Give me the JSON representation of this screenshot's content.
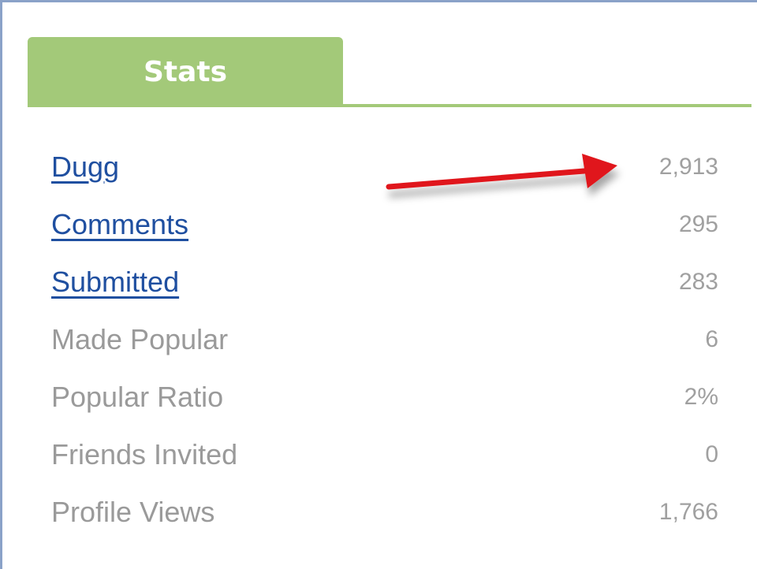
{
  "tab": {
    "label": "Stats"
  },
  "stats": [
    {
      "label": "Dugg",
      "value": "2,913",
      "link": true
    },
    {
      "label": "Comments",
      "value": "295",
      "link": true
    },
    {
      "label": "Submitted",
      "value": "283",
      "link": true
    },
    {
      "label": "Made Popular",
      "value": "6",
      "link": false
    },
    {
      "label": "Popular Ratio",
      "value": "2%",
      "link": false
    },
    {
      "label": "Friends Invited",
      "value": "0",
      "link": false
    },
    {
      "label": "Profile Views",
      "value": "1,766",
      "link": false
    }
  ],
  "colors": {
    "tab_green": "#a3c979",
    "link_blue": "#1f4fa0",
    "muted_text": "#9a9a9a",
    "arrow_red": "#e0191b"
  }
}
